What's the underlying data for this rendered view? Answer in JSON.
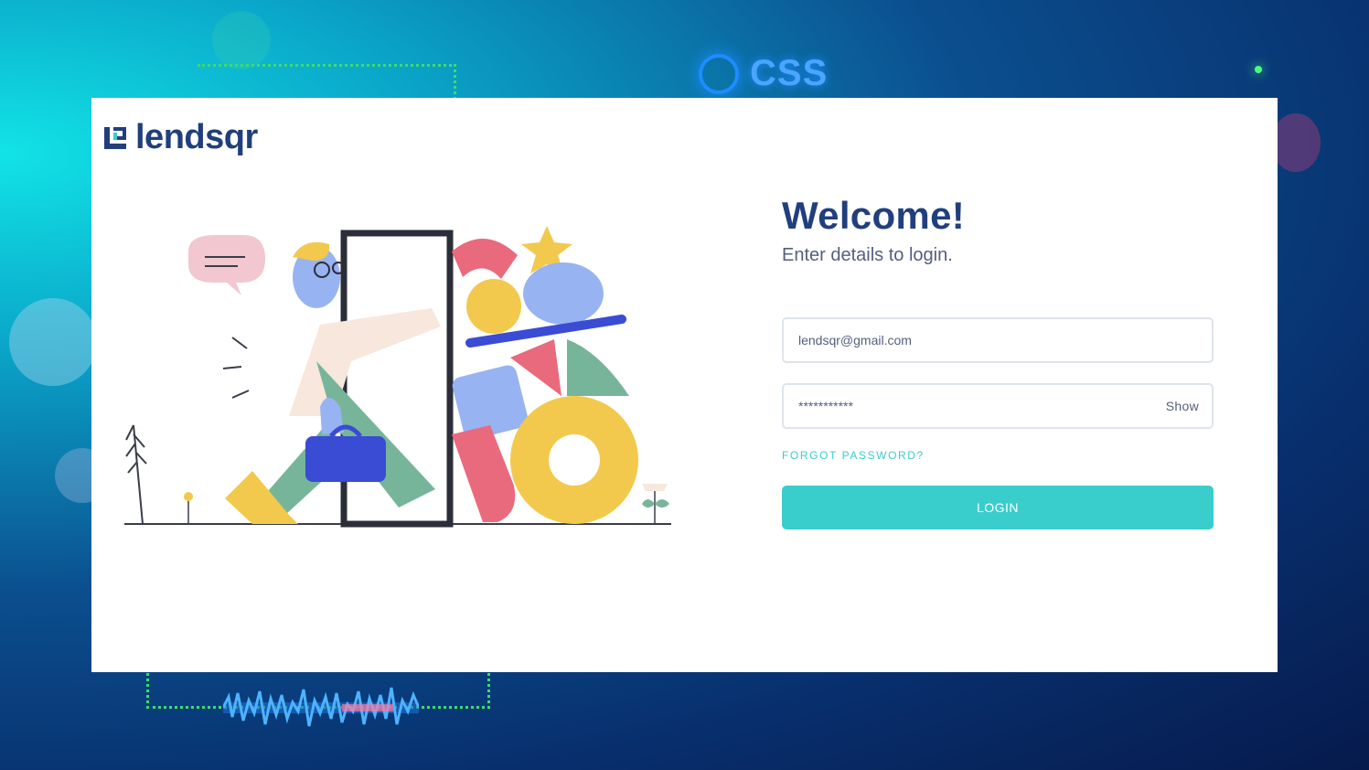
{
  "background": {
    "badge_text": "CSS"
  },
  "brand": {
    "name": "lendsqr",
    "color": "#213f7d"
  },
  "login": {
    "title": "Welcome!",
    "subtitle": "Enter details to login.",
    "email": {
      "value": "lendsqr@gmail.com"
    },
    "password": {
      "value": "***********",
      "toggle_label": "Show"
    },
    "forgot_label": "FORGOT PASSWORD?",
    "submit_label": "LOGIN",
    "accent_color": "#39cdcc"
  },
  "icons": [
    "lendsqr-logo-icon",
    "onboarding-illustration",
    "css-badge-icon"
  ]
}
